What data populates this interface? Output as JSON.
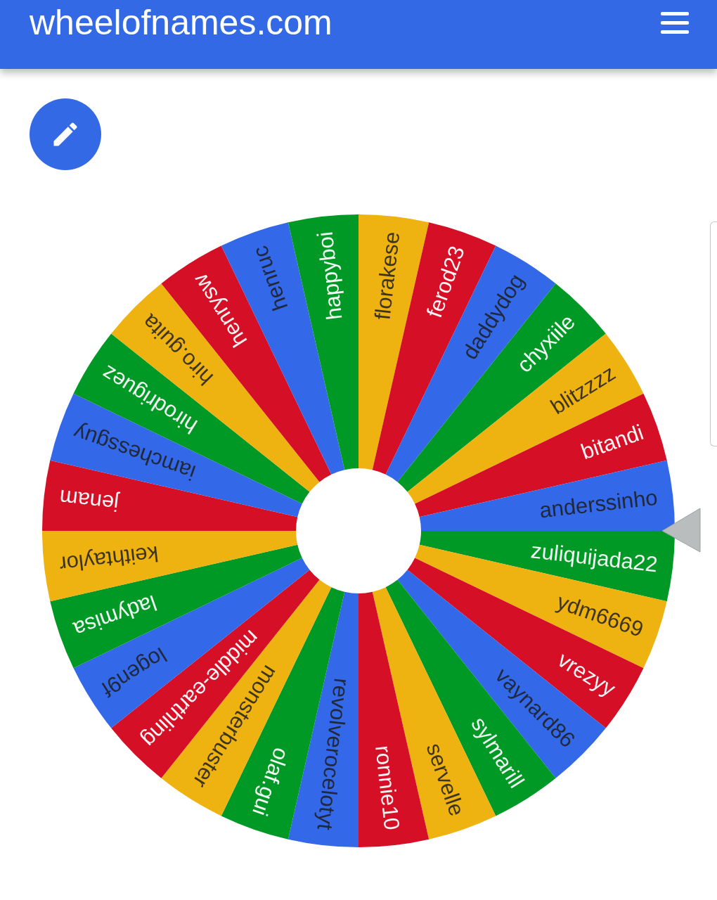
{
  "header": {
    "title": "wheelofnames.com"
  },
  "wheel": {
    "segments": [
      {
        "name": "florakese",
        "color": "#eeb211"
      },
      {
        "name": "ferod23",
        "color": "#d50f25"
      },
      {
        "name": "daddydog",
        "color": "#3369e8"
      },
      {
        "name": "chyxiile",
        "color": "#009925"
      },
      {
        "name": "blitzzzz",
        "color": "#eeb211"
      },
      {
        "name": "bitandi",
        "color": "#d50f25"
      },
      {
        "name": "anderssinho",
        "color": "#3369e8"
      },
      {
        "name": "zuliquijada22",
        "color": "#009925"
      },
      {
        "name": "ydm6669",
        "color": "#eeb211"
      },
      {
        "name": "vrezyy",
        "color": "#d50f25"
      },
      {
        "name": "vaynard86",
        "color": "#3369e8"
      },
      {
        "name": "sylmarill",
        "color": "#009925"
      },
      {
        "name": "servelle",
        "color": "#eeb211"
      },
      {
        "name": "ronnie10",
        "color": "#d50f25"
      },
      {
        "name": "revolverocelotyt",
        "color": "#3369e8"
      },
      {
        "name": "olaf.gui",
        "color": "#009925"
      },
      {
        "name": "monsterbuster",
        "color": "#eeb211"
      },
      {
        "name": "middle-earthling",
        "color": "#d50f25"
      },
      {
        "name": "logen9f",
        "color": "#3369e8"
      },
      {
        "name": "ladymisa",
        "color": "#009925"
      },
      {
        "name": "keithtaylor",
        "color": "#eeb211"
      },
      {
        "name": "jenam",
        "color": "#d50f25"
      },
      {
        "name": "iamchessguy",
        "color": "#3369e8"
      },
      {
        "name": "hirodriguez",
        "color": "#009925"
      },
      {
        "name": "hiro.guita",
        "color": "#eeb211"
      },
      {
        "name": "henrysw",
        "color": "#d50f25"
      },
      {
        "name": "henruc",
        "color": "#3369e8"
      },
      {
        "name": "happyboi",
        "color": "#009925"
      }
    ]
  }
}
